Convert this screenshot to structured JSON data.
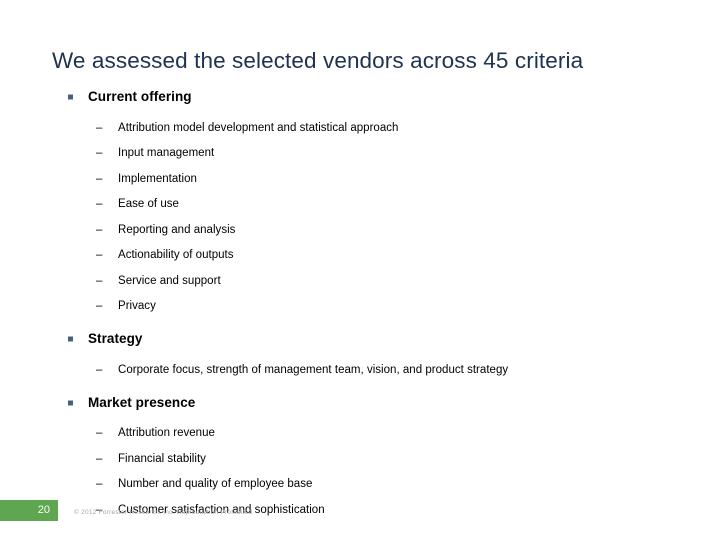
{
  "slide": {
    "title": "We assessed the selected vendors across 45 criteria",
    "title_color": "#1F3250",
    "background_color": "#ffffff",
    "level1_marker_color": "#46617F",
    "body_text_color": "#000000"
  },
  "groups": [
    {
      "heading": "Current offering",
      "items": [
        "Attribution model development and statistical approach",
        "Input management",
        "Implementation",
        "Ease of use",
        "Reporting and analysis",
        "Actionability of outputs",
        "Service and support",
        "Privacy"
      ]
    },
    {
      "heading": "Strategy",
      "items": [
        "Corporate focus, strength of management team, vision, and product strategy"
      ]
    },
    {
      "heading": "Market presence",
      "items": [
        "Attribution revenue",
        "Financial stability",
        "Number and quality of employee base",
        "Customer satisfaction and sophistication"
      ]
    }
  ],
  "markers": {
    "level1": "▪",
    "level2": "–"
  },
  "footer": {
    "page_number": "20",
    "page_block_color": "#5FA650",
    "copyright": "© 2012 Forrester Research, Inc. Reproduction Prohibited"
  }
}
